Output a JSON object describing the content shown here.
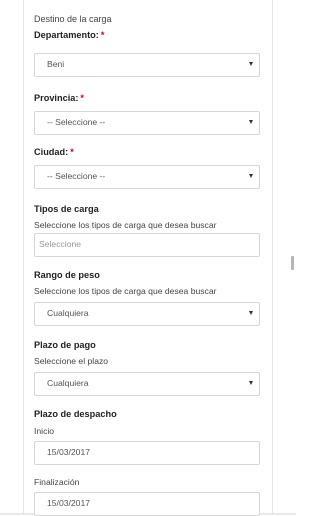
{
  "section_title": "Destino de la carga",
  "required_mark": "*",
  "departamento": {
    "label": "Departamento:",
    "value": "Beni"
  },
  "provincia": {
    "label": "Provincia:",
    "value": "-- Seleccione --"
  },
  "ciudad": {
    "label": "Ciudad:",
    "value": "-- Seleccione --"
  },
  "tipos_carga": {
    "label": "Tipos de carga",
    "help": "Seleccione los tipos de carga que desea buscar",
    "placeholder": "Seleccione"
  },
  "rango_peso": {
    "label": "Rango de peso",
    "help": "Seleccione los tipos de carga que desea buscar",
    "value": "Cualquiera"
  },
  "plazo_pago": {
    "label": "Plazo de pago",
    "help": "Seleccione el plazo",
    "value": "Cualquiera"
  },
  "plazo_despacho": {
    "label": "Plazo de despacho",
    "inicio_label": "Inicio",
    "inicio_value": "15/03/2017",
    "fin_label": "Finalización",
    "fin_value": "15/03/2017"
  }
}
